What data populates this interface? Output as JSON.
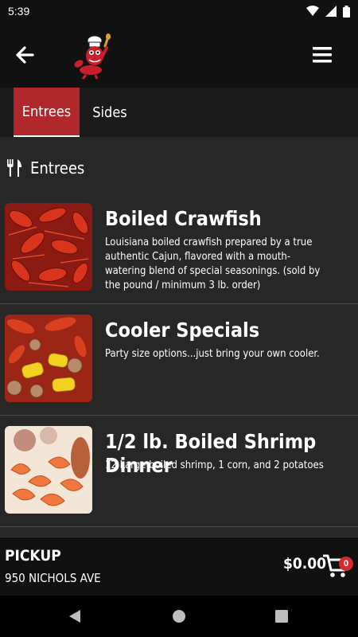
{
  "status_bar": {
    "time": "5:39"
  },
  "tabs": [
    {
      "label": "Entrees",
      "active": true
    },
    {
      "label": "Sides",
      "active": false
    }
  ],
  "section": {
    "title": "Entrees",
    "icon": "utensils-icon"
  },
  "items": [
    {
      "name": "Boiled Crawfish",
      "description": "Louisiana boiled crawfish prepared by a true authentic Cajun, flavored with a mouth-watering blend of special seasonings. (sold by the pound / minimum 3 lb. order)",
      "image": "crawfish-photo"
    },
    {
      "name": "Cooler Specials",
      "description": "Party size options...just bring your own cooler.",
      "image": "crawfish-corn-potatoes-photo"
    },
    {
      "name": "1/2 lb. Boiled Shrimp Dinner",
      "description": "12 Large boiled shrimp, 1 corn, and 2 potatoes",
      "image": "shrimp-dinner-photo"
    }
  ],
  "footer": {
    "pickup_label": "PICKUP",
    "address": "950 NICHOLS AVE",
    "total": "$0.00",
    "cart_count": "0"
  },
  "colors": {
    "accent": "#b0272c",
    "background": "#272727",
    "bar": "#111111"
  }
}
